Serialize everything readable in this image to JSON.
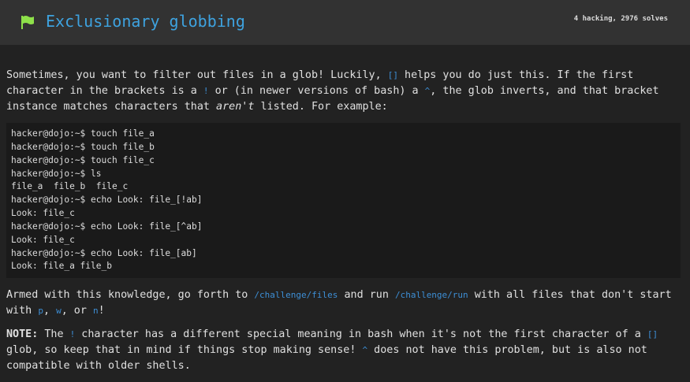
{
  "header": {
    "title": "Exclusionary globbing",
    "stats": "4 hacking, 2976 solves",
    "flag_color": "#8ee04a"
  },
  "p1": {
    "a": "Sometimes, you want to filter out files in a glob! Luckily, ",
    "code1": "[]",
    "b": " helps you do just this. If the first character in the brackets is a ",
    "code2": "!",
    "c": " or (in newer versions of bash) a ",
    "code3": "^",
    "d": ", the glob inverts, and that bracket instance matches characters that ",
    "em": "aren't",
    "e": " listed. For example:"
  },
  "code_lines": [
    "hacker@dojo:~$ touch file_a",
    "hacker@dojo:~$ touch file_b",
    "hacker@dojo:~$ touch file_c",
    "hacker@dojo:~$ ls",
    "file_a  file_b  file_c",
    "hacker@dojo:~$ echo Look: file_[!ab]",
    "Look: file_c",
    "hacker@dojo:~$ echo Look: file_[^ab]",
    "Look: file_c",
    "hacker@dojo:~$ echo Look: file_[ab]",
    "Look: file_a file_b"
  ],
  "p2": {
    "a": "Armed with this knowledge, go forth to ",
    "code1": "/challenge/files",
    "b": " and run ",
    "code2": "/challenge/run",
    "c": " with all files that don't start with ",
    "code3": "p",
    "d": ", ",
    "code4": "w",
    "e": ", or ",
    "code5": "n",
    "f": "!"
  },
  "p3": {
    "strong": "NOTE:",
    "a": " The ",
    "code1": "!",
    "b": " character has a different special meaning in bash when it's not the first character of a ",
    "code2": "[]",
    "c": " glob, so keep that in mind if things stop making sense! ",
    "code3": "^",
    "d": " does not have this problem, but is also not compatible with older shells."
  }
}
